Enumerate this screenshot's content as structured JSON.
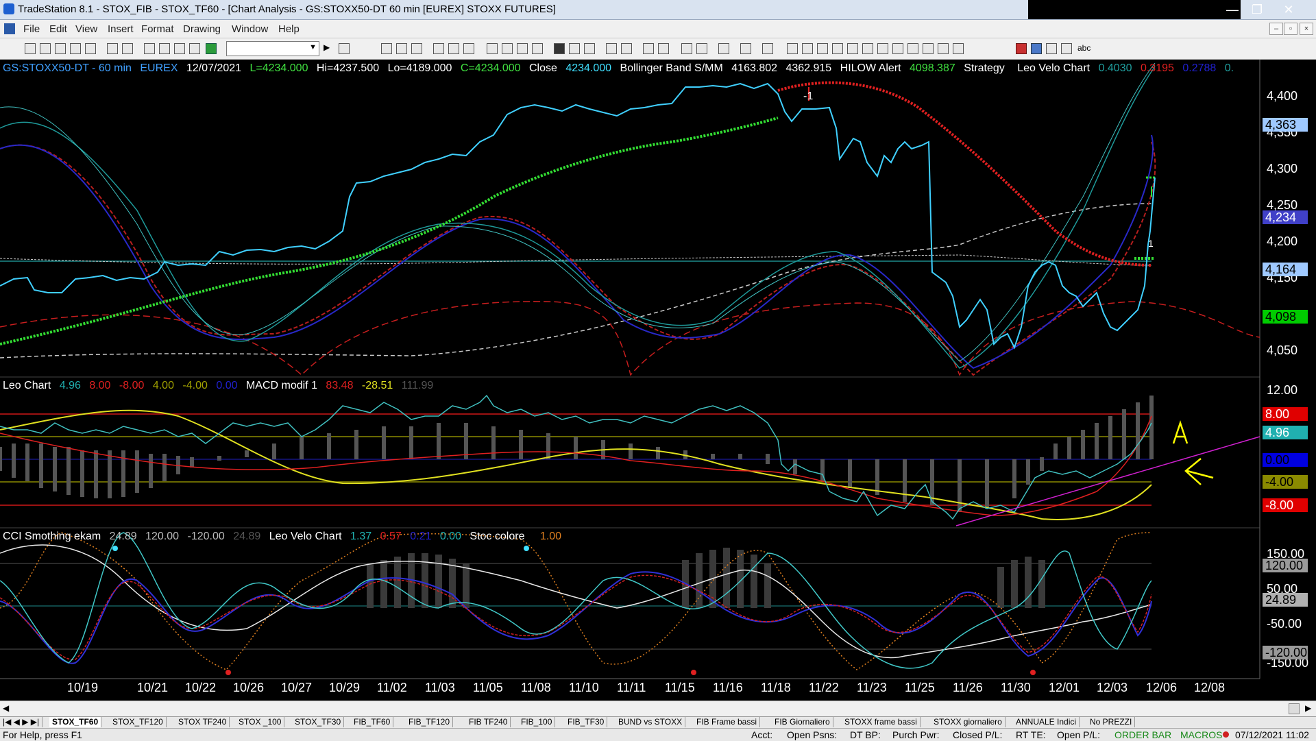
{
  "window": {
    "title": "TradeStation 8.1 - STOX_FIB - STOX_TF60 - [Chart Analysis - GS:STOXX50-DT  60 min  [EUREX] STOXX FUTURES]",
    "minimize": "—",
    "restore": "❐",
    "close": "✕"
  },
  "menu": [
    "File",
    "Edit",
    "View",
    "Insert",
    "Format",
    "Drawing",
    "Window",
    "Help"
  ],
  "toolbar": {
    "combo_value": "",
    "abc": "abc"
  },
  "price_panel": {
    "symbol": "GS:STOXX50-DT - 60 min",
    "exchange": "EUREX",
    "date": "12/07/2021",
    "last": "L=4234.000",
    "hi": "Hi=4237.500",
    "lo": "Lo=4189.000",
    "close_lbl": "C=4234.000",
    "close_word": "Close",
    "close_val": "4234.000",
    "bb_name": "Bollinger Band S/MM",
    "bb_low": "4163.802",
    "bb_high": "4362.915",
    "hilow_name": "HILOW Alert",
    "hilow_val": "4098.387",
    "strategy": "Strategy",
    "velo_name": "Leo Velo Chart",
    "velo_v1": "0.4030",
    "velo_v2": "0.3195",
    "velo_v3": "0.2788",
    "velo_v4": "0.",
    "axis": [
      "4,400",
      "4,350",
      "4,300",
      "4,250",
      "4,200",
      "4,150",
      "4,050"
    ],
    "tags": [
      {
        "label": "4,363",
        "bg": "#9fc9ff",
        "fg": "#000"
      },
      {
        "label": "4,234",
        "bg": "#4040c8",
        "fg": "#fff"
      },
      {
        "label": "4,164",
        "bg": "#9fc9ff",
        "fg": "#000"
      },
      {
        "label": "4,098",
        "bg": "#00cc00",
        "fg": "#000"
      }
    ],
    "annot_neg": "-1",
    "annot_pos": "1"
  },
  "leo_panel": {
    "name": "Leo Chart",
    "v1": "4.96",
    "v2": "8.00",
    "v3": "-8.00",
    "v4": "4.00",
    "v5": "-4.00",
    "v6": "0.00",
    "macd_name": "MACD modif 1",
    "m1": "83.48",
    "m2": "-28.51",
    "m3": "111.99",
    "axis": "12.00",
    "tags": [
      {
        "label": "8.00",
        "bg": "#e00000",
        "fg": "#fff"
      },
      {
        "label": "4.96",
        "bg": "#20b0b0",
        "fg": "#fff"
      },
      {
        "label": "0.00",
        "bg": "#0000e0",
        "fg": "#000"
      },
      {
        "label": "-4.00",
        "bg": "#8a8a00",
        "fg": "#000"
      },
      {
        "label": "-8.00",
        "bg": "#e00000",
        "fg": "#fff"
      }
    ]
  },
  "cci_panel": {
    "name": "CCI Smothing ekam",
    "v1": "24.89",
    "v2": "120.00",
    "v3": "-120.00",
    "v4": "24.89",
    "velo_name": "Leo Velo Chart",
    "w1": "1.37",
    "w2": "0.57",
    "w3": "0.21",
    "w4": "0.00",
    "stoc_name": "Stoc colore",
    "s1": "1.00",
    "axis": [
      "150.00",
      "50.00",
      "-50.00",
      "-150.00"
    ],
    "tags": [
      {
        "label": "120.00",
        "bg": "#9a9a9a",
        "fg": "#000"
      },
      {
        "label": "24.89",
        "bg": "#b0b0b0",
        "fg": "#000"
      },
      {
        "label": "-120.00",
        "bg": "#9a9a9a",
        "fg": "#000"
      }
    ]
  },
  "dates": [
    "10/19",
    "10/21",
    "10/22",
    "10/26",
    "10/27",
    "10/29",
    "11/02",
    "11/03",
    "11/05",
    "11/08",
    "11/10",
    "11/11",
    "11/15",
    "11/16",
    "11/18",
    "11/22",
    "11/23",
    "11/25",
    "11/26",
    "11/30",
    "12/01",
    "12/03",
    "12/06",
    "12/08"
  ],
  "annotations": {
    "a": "A"
  },
  "tabs": [
    "STOX_TF60",
    "STOX_TF120",
    "STOX TF240",
    "STOX _100",
    "STOX_TF30",
    "FIB_TF60",
    "FIB_TF120",
    "FIB TF240",
    "FIB_100",
    "FIB_TF30",
    "BUND vs STOXX",
    "FIB Frame bassi",
    "FIB Giornaliero",
    "STOXX frame bassi",
    "STOXX giornaliero",
    "ANNUALE Indici",
    "No PREZZI"
  ],
  "status": {
    "help": "For Help, press F1",
    "acct": "Acct:",
    "open_psns": "Open Psns:",
    "dtbp": "DT BP:",
    "purch": "Purch Pwr:",
    "closed": "Closed P/L:",
    "rtte": "RT TE:",
    "openpl": "Open P/L:",
    "orderbar": "ORDER BAR",
    "macros": "MACROS",
    "datetime": "07/12/2021 11:02"
  }
}
